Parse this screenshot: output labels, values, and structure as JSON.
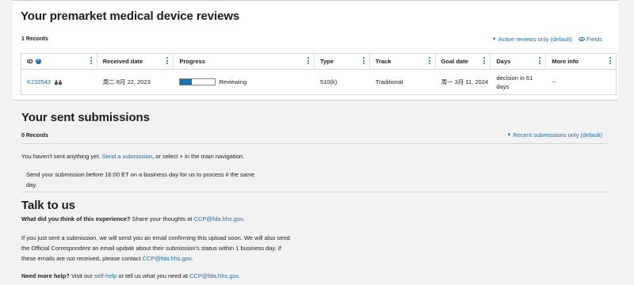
{
  "reviews": {
    "title": "Your premarket medical device reviews",
    "count": "1 Records",
    "filter_label": "Active reviews only (default)",
    "fields_label": "Fields",
    "columns": [
      "ID",
      "Received date",
      "Progress",
      "Type",
      "Track",
      "Goal date",
      "Days",
      "More info"
    ],
    "rows": [
      {
        "id": "K232543",
        "received": "周二 8月 22, 2023",
        "progress_status": "Reviewing",
        "progress_fraction": 0.33,
        "type": "510(k)",
        "track": "Traditional",
        "goal_date": "周一 3月 11, 2024",
        "days": "decision in 61 days",
        "more_info": "--"
      }
    ]
  },
  "sent": {
    "title": "Your sent submissions",
    "count": "0 Records",
    "filter_label": "Recent submissions only (default)",
    "empty_prefix": "You haven't sent anything yet.",
    "empty_link": "Send a submission",
    "empty_suffix": ", or select + in the main navigation.",
    "deadline_note": "Send your submission before 16:00 ET on a business day for us to process it the same day."
  },
  "talk": {
    "title": "Talk to us",
    "q1_bold": "What did you think of this experience?",
    "q1_text": " Share your thoughts at ",
    "email": "CCP@fda.hhs.gov",
    "q1_end": ".",
    "p2_text": "If you just sent a submission, we will send you an email confirming this upload soon. We will also send the Official Correspondent an email update about their submission's status within 1 business day. If these emails are not received, please contact ",
    "p2_end": ".",
    "help_bold": "Need more help?",
    "help_text1": " Visit our ",
    "help_link": "self-help",
    "help_text2": " or tell us what you need at ",
    "help_end": "."
  },
  "colors": {
    "link": "#1a6fb5",
    "progress_fill": "#1a6fb5"
  },
  "icons": [
    "help-icon",
    "users-icon",
    "caret-down-icon",
    "eye-icon",
    "kebab-icon"
  ]
}
